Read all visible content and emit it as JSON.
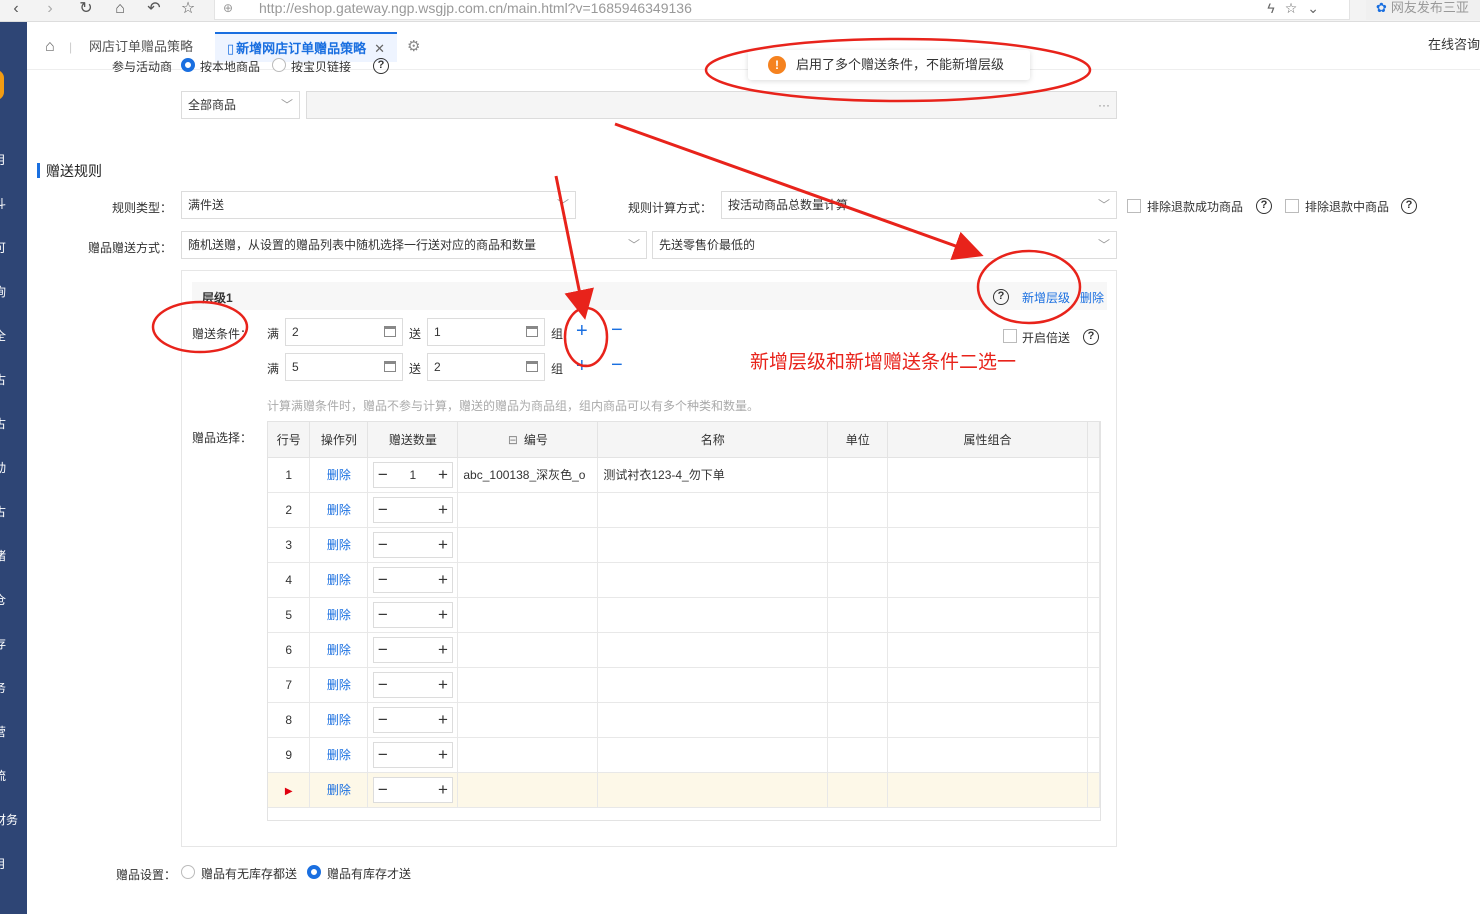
{
  "browser": {
    "url": "http://eshop.gateway.ngp.wsgjp.com.cn/main.html?v=1685946349136",
    "news_label": "网友发布三亚"
  },
  "sidebar": {
    "items": [
      "月",
      "斗",
      "可",
      "询",
      "全",
      "古",
      "古",
      "动",
      "古",
      "诸",
      "仓",
      "存",
      "务",
      "营",
      "流",
      "财务",
      "月"
    ]
  },
  "tabs": {
    "tab1": "网店订单赠品策略",
    "tab2": "新增网店订单赠品策略",
    "online": "在线咨询"
  },
  "toast": {
    "message": "启用了多个赠送条件，不能新增层级"
  },
  "top": {
    "goods_label": "参与活动商品：",
    "goods_opt1": "按本地商品",
    "goods_opt2": "按宝贝链接",
    "goods_select": "全部商品"
  },
  "section": {
    "title": "赠送规则"
  },
  "rule": {
    "type_label": "规则类型：",
    "type_value": "满件送",
    "calc_label": "规则计算方式：",
    "calc_value": "按活动商品总数量计算",
    "exclude_refunded": "排除退款成功商品",
    "exclude_refunding": "排除退款中商品",
    "method_label": "赠品赠送方式：",
    "method_value": "随机送赠，从设置的赠品列表中随机选择一行送对应的商品和数量",
    "priority_value": "先送零售价最低的"
  },
  "level": {
    "title": "层级1",
    "add_level": "新增层级",
    "delete": "删除",
    "double": "开启倍送",
    "cond_label": "赠送条件：",
    "man": "满",
    "song": "送",
    "zu": "组",
    "conditions": [
      {
        "full": "2",
        "give": "1"
      },
      {
        "full": "5",
        "give": "2"
      }
    ],
    "hint": "计算满赠条件时，赠品不参与计算，赠送的赠品为商品组，组内商品可以有多个种类和数量。",
    "gift_label": "赠品选择："
  },
  "grid": {
    "headers": [
      "行号",
      "操作列",
      "赠送数量",
      "编号",
      "名称",
      "单位",
      "属性组合"
    ],
    "delete_label": "删除",
    "rows": [
      {
        "no": "1",
        "qty": "1",
        "code": "abc_100138_深灰色_o",
        "name": "测试衬衣123-4_勿下单"
      },
      {
        "no": "2",
        "qty": "",
        "code": "",
        "name": ""
      },
      {
        "no": "3",
        "qty": "",
        "code": "",
        "name": ""
      },
      {
        "no": "4",
        "qty": "",
        "code": "",
        "name": ""
      },
      {
        "no": "5",
        "qty": "",
        "code": "",
        "name": ""
      },
      {
        "no": "6",
        "qty": "",
        "code": "",
        "name": ""
      },
      {
        "no": "7",
        "qty": "",
        "code": "",
        "name": ""
      },
      {
        "no": "8",
        "qty": "",
        "code": "",
        "name": ""
      },
      {
        "no": "9",
        "qty": "",
        "code": "",
        "name": ""
      },
      {
        "no": "▶",
        "qty": "",
        "code": "",
        "name": ""
      }
    ]
  },
  "gift_setting": {
    "label": "赠品设置：",
    "opt1": "赠品有无库存都送",
    "opt2": "赠品有库存才送"
  },
  "annotation": {
    "text": "新增层级和新增赠送条件二选一",
    "color": "#e8231b"
  },
  "colors": {
    "accent": "#1a6fe0",
    "sidebar": "#2e4575",
    "warning": "#f5821f"
  }
}
